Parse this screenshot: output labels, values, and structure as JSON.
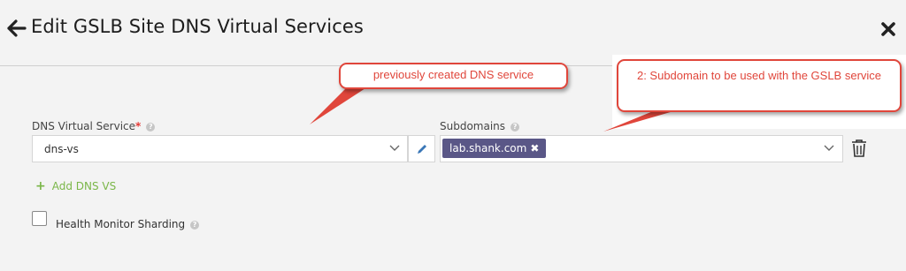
{
  "header": {
    "title": "Edit GSLB Site DNS Virtual Services",
    "back_icon": "arrow-left-icon",
    "close_icon": "close-x-icon"
  },
  "form": {
    "dns_vs_label": "DNS Virtual Service",
    "required_mark": "*",
    "dns_vs_value": "dns-vs",
    "subdomains_label": "Subdomains",
    "subdomain_chip": "lab.shank.com",
    "add_link": "Add DNS VS",
    "add_plus": "+",
    "health_monitor_label": "Health Monitor Sharding",
    "health_monitor_checked": false
  },
  "annotations": {
    "callout1": "previously created DNS service",
    "callout2": "2: Subdomain to be used with the GSLB service"
  },
  "colors": {
    "background": "#f3f3f3",
    "chip_bg": "#5a5787",
    "add_link": "#7ab648",
    "pencil": "#3a77b7",
    "callout_red": "#e0463b",
    "required": "#e53935"
  },
  "icons": [
    "arrow-left-icon",
    "close-x-icon",
    "help-icon",
    "chevron-down-icon",
    "pencil-icon",
    "trash-icon",
    "plus-icon"
  ]
}
